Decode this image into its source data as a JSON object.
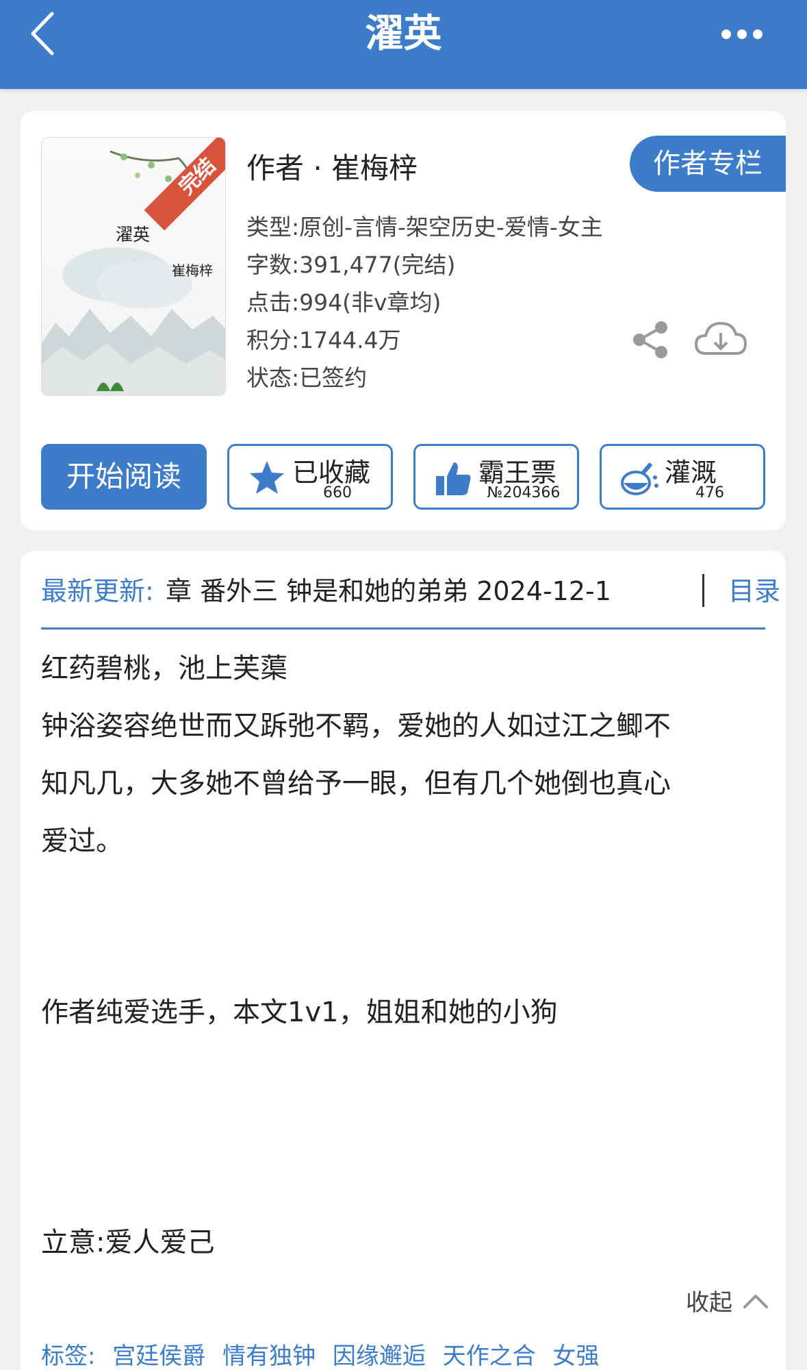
{
  "header": {
    "title": "濯英"
  },
  "book": {
    "cover_title": "濯英",
    "cover_author": "崔梅梓",
    "cover_badge": "完结",
    "author": "作者 · 崔梅梓",
    "author_column": "作者专栏",
    "meta": [
      "类型:原创-言情-架空历史-爱情-女主",
      "字数:391,477(完结)",
      "点击:994(非v章均)",
      "积分:1744.4万",
      "状态:已签约"
    ]
  },
  "actions": {
    "read": "开始阅读",
    "favorite": {
      "label": "已收藏",
      "count": "660"
    },
    "overlord": {
      "label": "霸王票",
      "count": "№204366"
    },
    "nutrient": {
      "label": "灌溉",
      "count": "476"
    }
  },
  "latest": {
    "label": "最新更新:",
    "text": "章 番外三   钟是和她的弟弟 2024-12-1",
    "toc": "目录"
  },
  "description": {
    "lines": [
      "红药碧桃，池上芙蕖",
      "钟浴姿容绝世而又跅弛不羁，爱她的人如过江之鲫不",
      "知凡几，大多她不曾给予一眼，但有几个她倒也真心",
      "爱过。",
      "作者纯爱选手，本文1v1，姐姐和她的小狗",
      "立意:爱人爱己"
    ],
    "collapse": "收起"
  },
  "tags": {
    "label": "标签:",
    "items": [
      "宫廷侯爵",
      "情有独钟",
      "因缘邂逅",
      "天作之合",
      "女强"
    ]
  },
  "colors": {
    "primary": "#3c7cc8",
    "badge": "#d8533c"
  }
}
